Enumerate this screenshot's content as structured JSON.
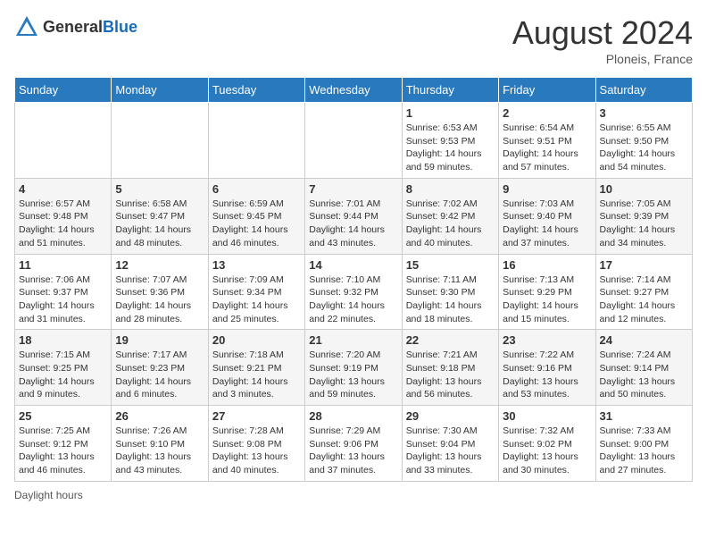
{
  "header": {
    "logo_general": "General",
    "logo_blue": "Blue",
    "month_year": "August 2024",
    "location": "Ploneis, France"
  },
  "days_of_week": [
    "Sunday",
    "Monday",
    "Tuesday",
    "Wednesday",
    "Thursday",
    "Friday",
    "Saturday"
  ],
  "weeks": [
    [
      {
        "day": "",
        "info": ""
      },
      {
        "day": "",
        "info": ""
      },
      {
        "day": "",
        "info": ""
      },
      {
        "day": "",
        "info": ""
      },
      {
        "day": "1",
        "info": "Sunrise: 6:53 AM\nSunset: 9:53 PM\nDaylight: 14 hours and 59 minutes."
      },
      {
        "day": "2",
        "info": "Sunrise: 6:54 AM\nSunset: 9:51 PM\nDaylight: 14 hours and 57 minutes."
      },
      {
        "day": "3",
        "info": "Sunrise: 6:55 AM\nSunset: 9:50 PM\nDaylight: 14 hours and 54 minutes."
      }
    ],
    [
      {
        "day": "4",
        "info": "Sunrise: 6:57 AM\nSunset: 9:48 PM\nDaylight: 14 hours and 51 minutes."
      },
      {
        "day": "5",
        "info": "Sunrise: 6:58 AM\nSunset: 9:47 PM\nDaylight: 14 hours and 48 minutes."
      },
      {
        "day": "6",
        "info": "Sunrise: 6:59 AM\nSunset: 9:45 PM\nDaylight: 14 hours and 46 minutes."
      },
      {
        "day": "7",
        "info": "Sunrise: 7:01 AM\nSunset: 9:44 PM\nDaylight: 14 hours and 43 minutes."
      },
      {
        "day": "8",
        "info": "Sunrise: 7:02 AM\nSunset: 9:42 PM\nDaylight: 14 hours and 40 minutes."
      },
      {
        "day": "9",
        "info": "Sunrise: 7:03 AM\nSunset: 9:40 PM\nDaylight: 14 hours and 37 minutes."
      },
      {
        "day": "10",
        "info": "Sunrise: 7:05 AM\nSunset: 9:39 PM\nDaylight: 14 hours and 34 minutes."
      }
    ],
    [
      {
        "day": "11",
        "info": "Sunrise: 7:06 AM\nSunset: 9:37 PM\nDaylight: 14 hours and 31 minutes."
      },
      {
        "day": "12",
        "info": "Sunrise: 7:07 AM\nSunset: 9:36 PM\nDaylight: 14 hours and 28 minutes."
      },
      {
        "day": "13",
        "info": "Sunrise: 7:09 AM\nSunset: 9:34 PM\nDaylight: 14 hours and 25 minutes."
      },
      {
        "day": "14",
        "info": "Sunrise: 7:10 AM\nSunset: 9:32 PM\nDaylight: 14 hours and 22 minutes."
      },
      {
        "day": "15",
        "info": "Sunrise: 7:11 AM\nSunset: 9:30 PM\nDaylight: 14 hours and 18 minutes."
      },
      {
        "day": "16",
        "info": "Sunrise: 7:13 AM\nSunset: 9:29 PM\nDaylight: 14 hours and 15 minutes."
      },
      {
        "day": "17",
        "info": "Sunrise: 7:14 AM\nSunset: 9:27 PM\nDaylight: 14 hours and 12 minutes."
      }
    ],
    [
      {
        "day": "18",
        "info": "Sunrise: 7:15 AM\nSunset: 9:25 PM\nDaylight: 14 hours and 9 minutes."
      },
      {
        "day": "19",
        "info": "Sunrise: 7:17 AM\nSunset: 9:23 PM\nDaylight: 14 hours and 6 minutes."
      },
      {
        "day": "20",
        "info": "Sunrise: 7:18 AM\nSunset: 9:21 PM\nDaylight: 14 hours and 3 minutes."
      },
      {
        "day": "21",
        "info": "Sunrise: 7:20 AM\nSunset: 9:19 PM\nDaylight: 13 hours and 59 minutes."
      },
      {
        "day": "22",
        "info": "Sunrise: 7:21 AM\nSunset: 9:18 PM\nDaylight: 13 hours and 56 minutes."
      },
      {
        "day": "23",
        "info": "Sunrise: 7:22 AM\nSunset: 9:16 PM\nDaylight: 13 hours and 53 minutes."
      },
      {
        "day": "24",
        "info": "Sunrise: 7:24 AM\nSunset: 9:14 PM\nDaylight: 13 hours and 50 minutes."
      }
    ],
    [
      {
        "day": "25",
        "info": "Sunrise: 7:25 AM\nSunset: 9:12 PM\nDaylight: 13 hours and 46 minutes."
      },
      {
        "day": "26",
        "info": "Sunrise: 7:26 AM\nSunset: 9:10 PM\nDaylight: 13 hours and 43 minutes."
      },
      {
        "day": "27",
        "info": "Sunrise: 7:28 AM\nSunset: 9:08 PM\nDaylight: 13 hours and 40 minutes."
      },
      {
        "day": "28",
        "info": "Sunrise: 7:29 AM\nSunset: 9:06 PM\nDaylight: 13 hours and 37 minutes."
      },
      {
        "day": "29",
        "info": "Sunrise: 7:30 AM\nSunset: 9:04 PM\nDaylight: 13 hours and 33 minutes."
      },
      {
        "day": "30",
        "info": "Sunrise: 7:32 AM\nSunset: 9:02 PM\nDaylight: 13 hours and 30 minutes."
      },
      {
        "day": "31",
        "info": "Sunrise: 7:33 AM\nSunset: 9:00 PM\nDaylight: 13 hours and 27 minutes."
      }
    ]
  ],
  "footer": {
    "daylight_label": "Daylight hours"
  }
}
